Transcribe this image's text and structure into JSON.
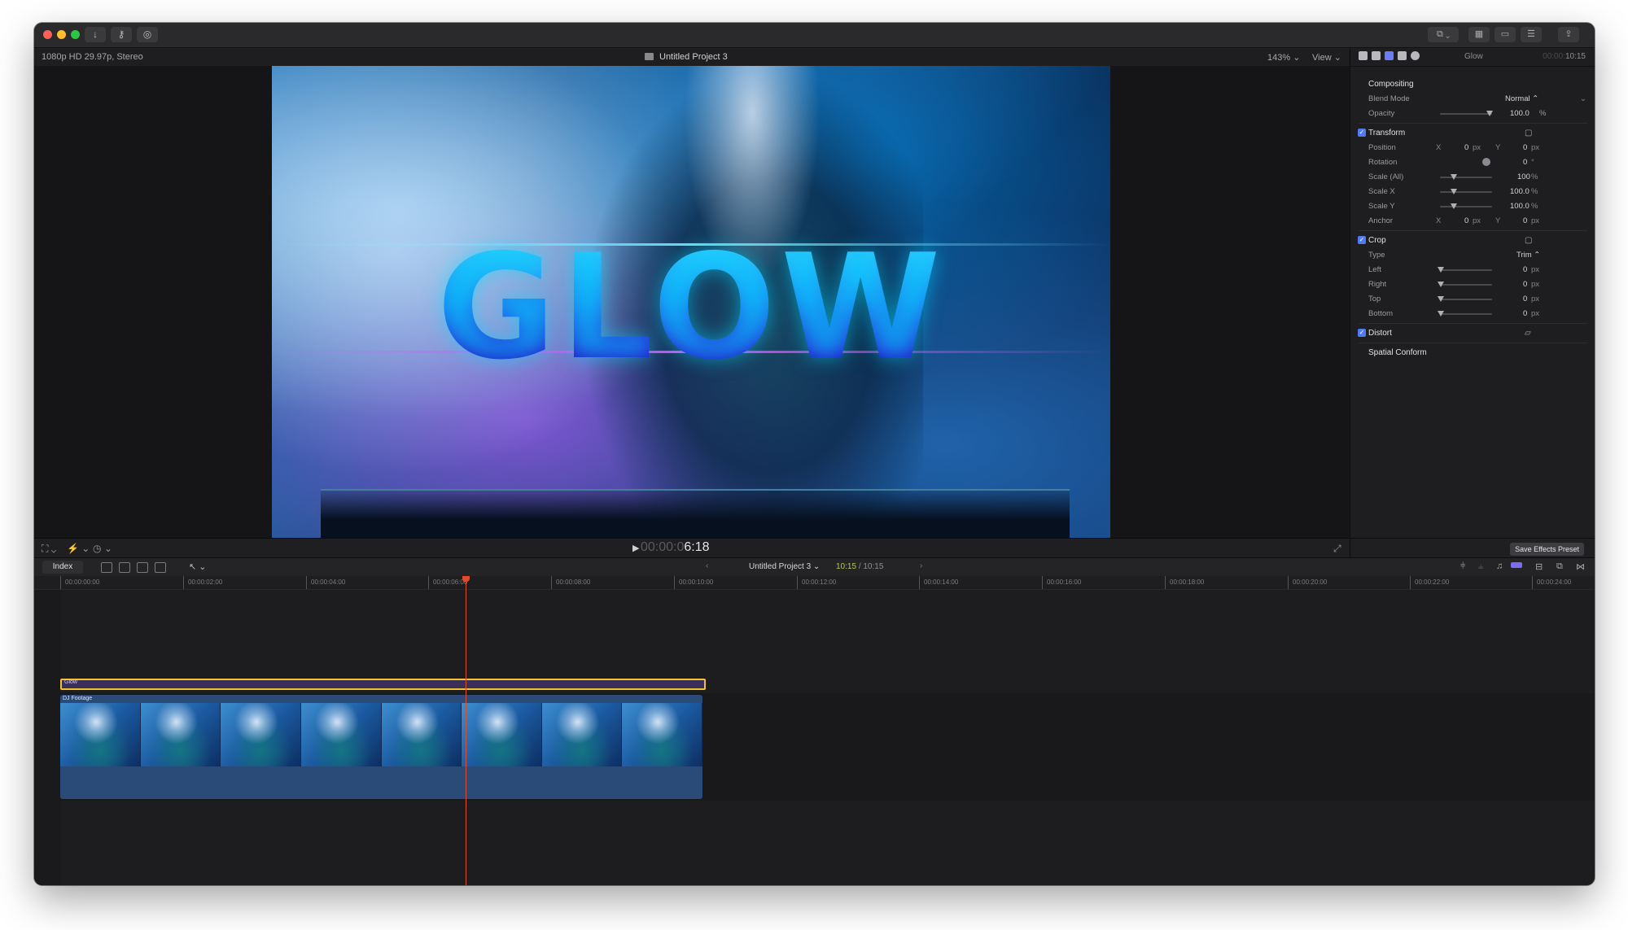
{
  "window": {
    "colors": {
      "close": "#ff5f57",
      "minimize": "#febc2e",
      "zoom": "#28c840",
      "accent": "#6c7cf5",
      "playhead": "#e24c2d",
      "title_clip_border": "#f2c22f"
    }
  },
  "toolbar": {
    "import_icon": "download-arrow-icon",
    "keywords_icon": "key-icon",
    "background_tasks_icon": "checkmark-circle-icon"
  },
  "viewer": {
    "format": "1080p HD 29.97p, Stereo",
    "project_title": "Untitled Project 3",
    "zoom": "143%",
    "view_label": "View",
    "overlay_text": "GLOW",
    "timecode_dim": "00:00:0",
    "timecode_bright": "6:18"
  },
  "inspector": {
    "clip_name": "Glow",
    "duration_dim": "00:00:",
    "duration": "10:15",
    "compositing": {
      "label": "Compositing",
      "blend_mode_label": "Blend Mode",
      "blend_mode_value": "Normal ⌃",
      "opacity_label": "Opacity",
      "opacity_value": "100.0",
      "opacity_unit": "%"
    },
    "transform": {
      "label": "Transform",
      "position_label": "Position",
      "position_x_axis": "X",
      "position_x": "0",
      "position_y_axis": "Y",
      "position_y": "0",
      "px_unit": "px",
      "rotation_label": "Rotation",
      "rotation_value": "0",
      "rotation_unit": "°",
      "scale_all_label": "Scale (All)",
      "scale_all_value": "100",
      "scale_x_label": "Scale X",
      "scale_x_value": "100.0",
      "scale_y_label": "Scale Y",
      "scale_y_value": "100.0",
      "anchor_label": "Anchor",
      "anchor_x_axis": "X",
      "anchor_x": "0",
      "anchor_y_axis": "Y",
      "anchor_y": "0",
      "percent_unit": "%"
    },
    "crop": {
      "label": "Crop",
      "type_label": "Type",
      "type_value": "Trim ⌃",
      "left_label": "Left",
      "left_value": "0",
      "right_label": "Right",
      "right_value": "0",
      "top_label": "Top",
      "top_value": "0",
      "bottom_label": "Bottom",
      "bottom_value": "0",
      "unit": "px"
    },
    "distort": {
      "label": "Distort"
    },
    "spatial_conform": {
      "label": "Spatial Conform"
    },
    "save_effects_preset": "Save Effects Preset"
  },
  "timeline": {
    "index_label": "Index",
    "project_title": "Untitled Project 3",
    "time_current": "10:15",
    "time_total": "/ 10:15",
    "ruler": [
      "00:00:00:00",
      "00:00:02:00",
      "00:00:04:00",
      "00:00:06:00",
      "00:00:08:00",
      "00:00:10:00",
      "00:00:12:00",
      "00:00:14:00",
      "00:00:16:00",
      "00:00:18:00",
      "00:00:20:00",
      "00:00:22:00",
      "00:00:24:00"
    ],
    "title_clip_name": "Glow",
    "video_clip_name": "DJ Footage"
  }
}
